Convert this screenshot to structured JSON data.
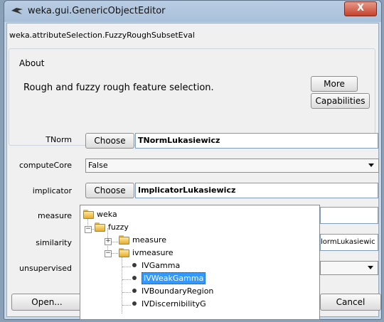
{
  "window": {
    "title": "weka.gui.GenericObjectEditor",
    "close_label": "X"
  },
  "class_name": "weka.attributeSelection.FuzzyRoughSubsetEval",
  "about": {
    "title": "About",
    "text": "Rough and fuzzy rough feature selection.",
    "more_label": "More",
    "capabilities_label": "Capabilities"
  },
  "properties": {
    "tnorm": {
      "label": "TNorm",
      "choose_label": "Choose",
      "value": "TNormLukasiewicz"
    },
    "computecore": {
      "label": "computeCore",
      "value": "False"
    },
    "implicator": {
      "label": "implicator",
      "choose_label": "Choose",
      "value": "ImplicatorLukasiewicz"
    },
    "measure": {
      "label": "measure"
    },
    "similarity": {
      "label": "similarity",
      "value_visible": "lormLukasiewic"
    },
    "unsupervised": {
      "label": "unsupervised"
    }
  },
  "buttons": {
    "open_label": "Open...",
    "cancel_label": "Cancel"
  },
  "tree": {
    "root": "weka",
    "fuzzy": "fuzzy",
    "measure": "measure",
    "ivmeasure": "ivmeasure",
    "leaves": [
      "IVGamma",
      "IVWeakGamma",
      "IVBoundaryRegion",
      "IVDiscernibilityG"
    ],
    "selected": "IVWeakGamma"
  },
  "colors": {
    "selection": "#3399ff",
    "title_bar": "#b9cde3",
    "close_button": "#c5422c"
  }
}
